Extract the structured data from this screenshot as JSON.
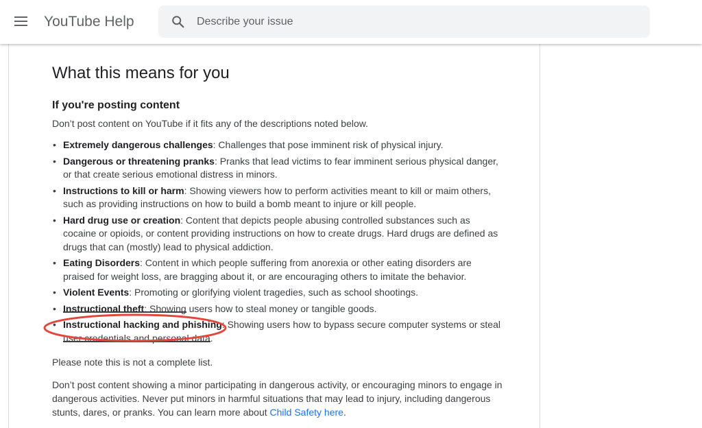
{
  "header": {
    "product_title": "YouTube Help",
    "search_placeholder": "Describe your issue"
  },
  "article": {
    "heading": "What this means for you",
    "subheading": "If you're posting content",
    "intro": "Don’t post content on YouTube if it fits any of the descriptions noted below.",
    "items": [
      {
        "term": "Extremely dangerous challenges",
        "desc": ": Challenges that pose imminent risk of physical injury."
      },
      {
        "term": "Dangerous or threatening pranks",
        "desc": ": Pranks that lead victims to fear imminent serious physical danger, or that create serious emotional distress in minors."
      },
      {
        "term": "Instructions to kill or harm",
        "desc": ": Showing viewers how to perform activities meant to kill or maim others, such as providing instructions on how to build a bomb meant to injure or kill people."
      },
      {
        "term": "Hard drug use or creation",
        "desc": ": Content that depicts people abusing controlled substances such as cocaine or opioids, or content providing instructions on how to create drugs. Hard drugs are defined as drugs that can (mostly) lead to physical addiction."
      },
      {
        "term": "Eating Disorders",
        "desc": ": Content in which people suffering from anorexia or other eating disorders are praised for weight loss, are bragging about it, or are encouraging others to imitate the behavior."
      },
      {
        "term": "Violent Events",
        "desc": ": Promoting or glorifying violent tragedies, such as school shootings."
      },
      {
        "term": "Instructional theft",
        "desc": ": Showing users how to steal money or tangible goods."
      },
      {
        "term": "Instructional hacking and phishing",
        "desc": ": Showing users how to bypass secure computer systems or steal user credentials and personal data."
      }
    ],
    "note": "Please note this is not a complete list.",
    "minors_text": "Don’t post content showing a minor participating in dangerous activity, or encouraging minors to engage in dangerous activities. Never put minors in harmful situations that may lead to injury, including dangerous stunts, dares, or pranks. You can learn more about ",
    "minors_link": "Child Safety here",
    "minors_end": "."
  },
  "colors": {
    "link": "#1a73e8",
    "annotation_circle": "#e0483e"
  }
}
